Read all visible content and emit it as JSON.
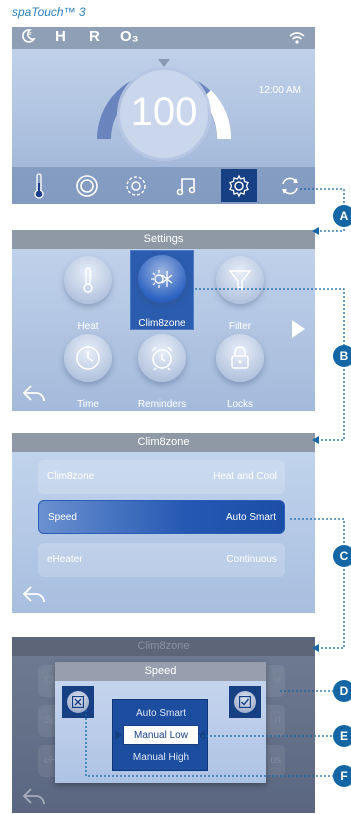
{
  "brand": "spaTouch™ 3",
  "screen1": {
    "status_icons": [
      "moon-icon",
      "H",
      "R",
      "O₃",
      "wifi-icon"
    ],
    "temperature": "100",
    "time": "12:00 AM",
    "nav": [
      "thermometer-icon",
      "circle-icon",
      "pump-icon",
      "music-icon",
      "gear-icon",
      "sync-icon"
    ],
    "selected_nav": "gear-icon"
  },
  "screen2": {
    "title": "Settings",
    "tiles": [
      {
        "label": "Heat",
        "icon": "thermometer-icon"
      },
      {
        "label": "Clim8zone",
        "icon": "sun-snowflake-icon",
        "selected": true
      },
      {
        "label": "Filter",
        "icon": "filter-funnel-icon"
      },
      {
        "label": "Time",
        "icon": "clock-icon"
      },
      {
        "label": "Reminders",
        "icon": "alarm-clock-icon"
      },
      {
        "label": "Locks",
        "icon": "lock-icon"
      }
    ]
  },
  "screen3": {
    "title": "Clim8zone",
    "rows": [
      {
        "label": "Clim8zone",
        "value": "Heat and Cool"
      },
      {
        "label": "Speed",
        "value": "Auto Smart",
        "selected": true
      },
      {
        "label": "eHeater",
        "value": "Continuous"
      }
    ]
  },
  "screen4": {
    "title": "Clim8zone",
    "bg_fragments": [
      "Cl",
      "Sp",
      "eH",
      "ol",
      "rt",
      "us"
    ],
    "dialog": {
      "title": "Speed",
      "options": [
        "Auto Smart",
        "Manual Low",
        "Manual High"
      ],
      "selected": "Manual Low"
    }
  },
  "callouts": [
    "A",
    "B",
    "C",
    "D",
    "E",
    "F"
  ],
  "colors": {
    "accent": "#1566a4",
    "selected_dark": "#173f84"
  }
}
